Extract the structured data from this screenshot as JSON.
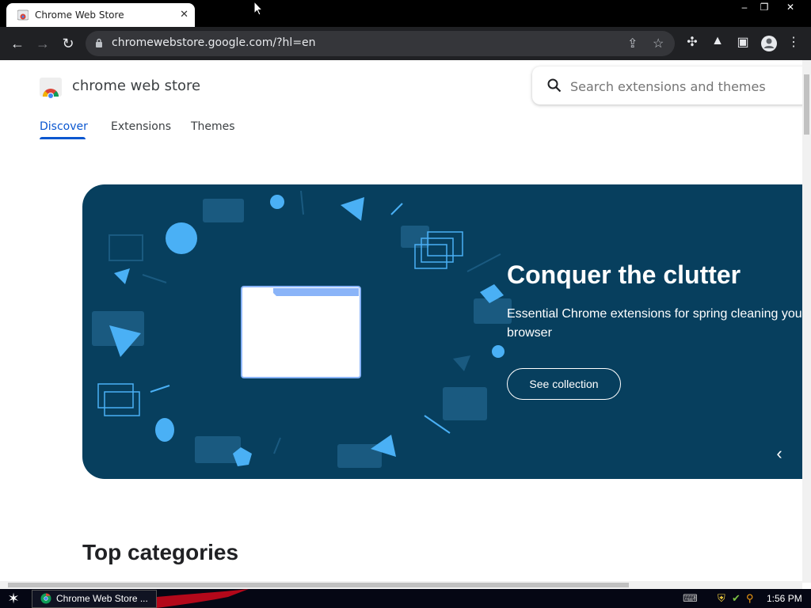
{
  "browser": {
    "tab_title": "Chrome Web Store",
    "tab_close": "✕",
    "url": "chromewebstore.google.com/?hl=en",
    "window_controls": [
      "‒",
      "❐",
      "✕"
    ]
  },
  "store": {
    "name": "chrome web store",
    "search_placeholder": "Search extensions and themes",
    "nav": [
      {
        "label": "Discover",
        "active": true
      },
      {
        "label": "Extensions",
        "active": false
      },
      {
        "label": "Themes",
        "active": false
      }
    ]
  },
  "hero": {
    "title": "Conquer the clutter",
    "description": "Essential Chrome extensions for spring cleaning your browser",
    "button": "See collection",
    "prev": "‹",
    "background": "#073f5e"
  },
  "sections": {
    "top_categories": "Top categories"
  },
  "taskbar": {
    "item_label": "Chrome Web Store ...",
    "clock": "1:56 PM"
  },
  "colors": {
    "accent": "#0b57d0",
    "hero_shape": "#4ab0f5"
  }
}
